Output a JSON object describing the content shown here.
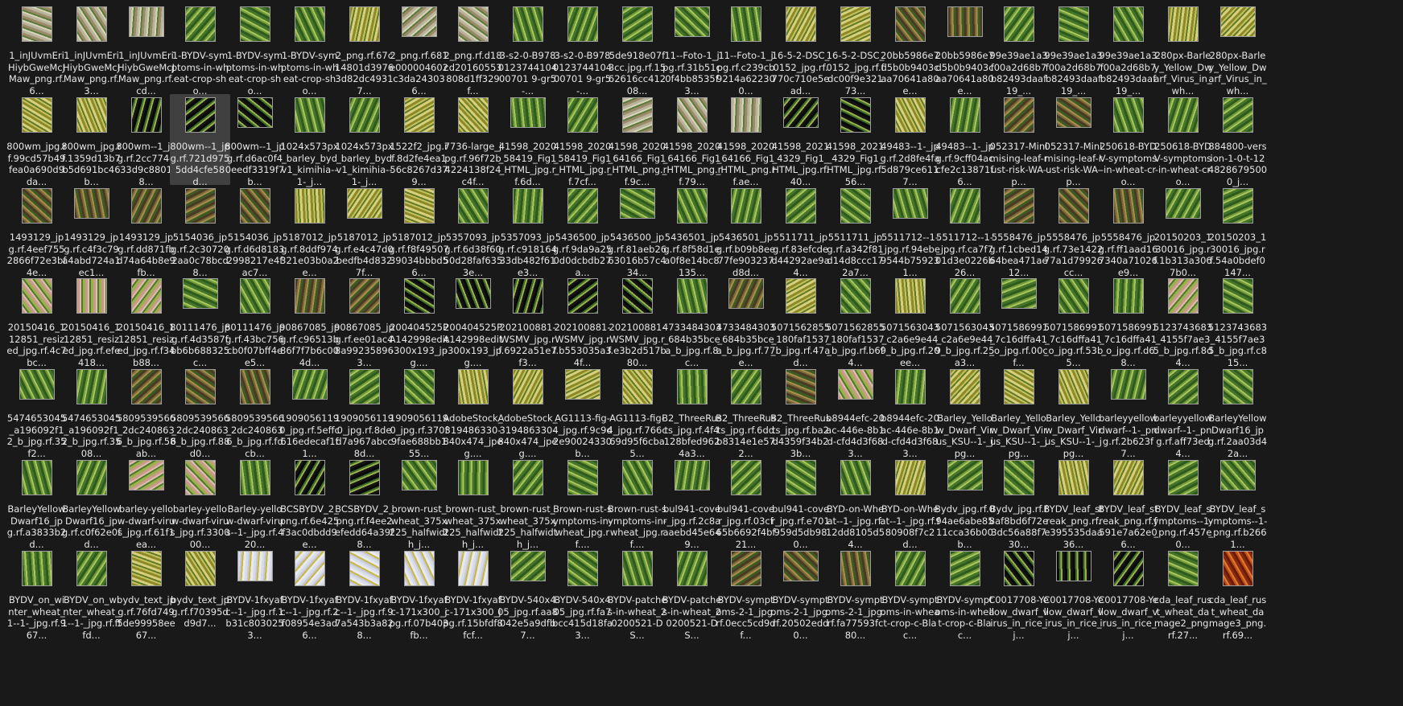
{
  "colors": {
    "background": "#191919",
    "text": "#e6e6e6",
    "selection": "#404040",
    "thumb_border": "#9c9c9c"
  },
  "files": [
    {
      "name": "1_inJUvmEriHiybGweMcJMaw_png.rf.6...",
      "thumb": "pale",
      "selected": false
    },
    {
      "name": "1_inJUvmEriHiybGweMcJMaw_png.rf.3...",
      "thumb": "pale",
      "selected": false
    },
    {
      "name": "1_inJUvmEriHiybGweMcJMaw_png.rf.cd...",
      "thumb": "pale",
      "selected": false
    },
    {
      "name": "1-BYDV-symptoms-in-wheat-crop-sho...",
      "thumb": "green",
      "selected": false
    },
    {
      "name": "1-BYDV-symptoms-in-wheat-crop-sho...",
      "thumb": "green",
      "selected": false
    },
    {
      "name": "1-BYDV-symptoms-in-wheat-crop-sho...",
      "thumb": "green",
      "selected": false
    },
    {
      "name": "2_png.rf.67c14801d39763d82dc49317...",
      "thumb": "yellow",
      "selected": false
    },
    {
      "name": "2_png.rf.681e000004602c3da243036...",
      "thumb": "pale",
      "selected": false
    },
    {
      "name": "2_png.rf.d18cd20160553808d1ff329f...",
      "thumb": "pale",
      "selected": false
    },
    {
      "name": "3-s2-0-B978012374410400701 9-gr5-...",
      "thumb": "green",
      "selected": false
    },
    {
      "name": "3-s2-0-B978012374410400701 9-gr5-...",
      "thumb": "green",
      "selected": false
    },
    {
      "name": "5de918e07f3cc.jpg.rf.1562616cc41208...",
      "thumb": "green",
      "selected": false
    },
    {
      "name": "11--Foto-1_jpg.rf.31b51c0f4bb8535f3...",
      "thumb": "green",
      "selected": false
    },
    {
      "name": "11--Foto-1_jpg.rf.c239cb9214a622300...",
      "thumb": "green",
      "selected": false
    },
    {
      "name": "16-5-2-DSC_0152_jpg.rf.770c710e5ead...",
      "thumb": "yellow",
      "selected": false
    },
    {
      "name": "16-5-2-DSC_0152_jpg.rf.fdc00f9e32173...",
      "thumb": "yellow",
      "selected": false
    },
    {
      "name": "20bb5986e7d5b0b9403caa70641a80e...",
      "thumb": "brown",
      "selected": false
    },
    {
      "name": "20bb5986e7d5b0b9403caa70641a80e...",
      "thumb": "brown",
      "selected": false
    },
    {
      "name": "99e39ae1a3f00a2d68b7b82493daaf19_...",
      "thumb": "green",
      "selected": false
    },
    {
      "name": "99e39ae1a3f00a2d68b7b82493daaf19_...",
      "thumb": "green",
      "selected": false
    },
    {
      "name": "99e39ae1a3f00a2d68b7b82493daaf19_...",
      "thumb": "green",
      "selected": false
    },
    {
      "name": "280px-Barley_Yellow_Dwarf_Virus_in_wh...",
      "thumb": "yellow",
      "selected": false
    },
    {
      "name": "280px-Barley_Yellow_Dwarf_Virus_in_wh...",
      "thumb": "yellow",
      "selected": false
    },
    {
      "name": "800wm_jpg.rf.99cd57b49fea0a690d9da...",
      "thumb": "yellow",
      "selected": false
    },
    {
      "name": "800wm_jpg.rf.1359d13b7b5d691bc46b...",
      "thumb": "yellow",
      "selected": false
    },
    {
      "name": "800wm--1_jpg.rf.2cc774e33d9c88018...",
      "thumb": "dark",
      "selected": false
    },
    {
      "name": "800wm--1_jpg.rf.721d9755dd4cfe58d...",
      "thumb": "dark",
      "selected": true
    },
    {
      "name": "800wm--1_jpg.rf.d6ac0f40eedf3319f7b...",
      "thumb": "dark",
      "selected": false
    },
    {
      "name": "1024x573px_barley_bydv1_kimihia--1-_j...",
      "thumb": "green",
      "selected": false
    },
    {
      "name": "1024x573px_barley_bydv1_kimihia--1-_j...",
      "thumb": "green",
      "selected": false
    },
    {
      "name": "1522f2_jpg.rf.8d2fe4ea156c8267d379...",
      "thumb": "yellow",
      "selected": false
    },
    {
      "name": "7736-large_jpg.rf.96f72b4224138f24c4f...",
      "thumb": "yellow",
      "selected": false
    },
    {
      "name": "41598_2020_58419_Fig1_HTML_jpg.rf.6d...",
      "thumb": "green",
      "selected": false
    },
    {
      "name": "41598_2020_58419_Fig1_HTML_jpg.rf.7cf...",
      "thumb": "green",
      "selected": false
    },
    {
      "name": "41598_2020_64166_Fig1_HTML_png.rf.9c...",
      "thumb": "pale",
      "selected": false
    },
    {
      "name": "41598_2020_64166_Fig1_HTML_png.rf.79...",
      "thumb": "pale",
      "selected": false
    },
    {
      "name": "41598_2020_64166_Fig1_HTML_png.rf.ae...",
      "thumb": "pale",
      "selected": false
    },
    {
      "name": "41598_2021_4329_Fig1_HTML_jpg.rf.40...",
      "thumb": "dark",
      "selected": false
    },
    {
      "name": "41598_2021_4329_Fig1_HTML_jpg.rf.56...",
      "thumb": "dark",
      "selected": false
    },
    {
      "name": "49483--1-_jpg.rf.2d8fe4fa5d879ce6117...",
      "thumb": "yellow",
      "selected": false
    },
    {
      "name": "49483--1-_jpg.rf.9cff04accfe2c13871f6...",
      "thumb": "green",
      "selected": false
    },
    {
      "name": "052317-Minimising-leaf-rust-risk-WA-p...",
      "thumb": "brown",
      "selected": false
    },
    {
      "name": "052317-Minimising-leaf-rust-risk-WA-p...",
      "thumb": "brown",
      "selected": false
    },
    {
      "name": "250618-BYDV-symptoms-in-wheat-cro...",
      "thumb": "green",
      "selected": false
    },
    {
      "name": "250618-BYDV-symptoms-in-wheat-cro...",
      "thumb": "green",
      "selected": false
    },
    {
      "name": "884800-version-1-0-t-1248286795000_j...",
      "thumb": "green",
      "selected": false
    },
    {
      "name": "1493129_jpg.rf.4eef7552866f72e3bf4e...",
      "thumb": "brown",
      "selected": false
    },
    {
      "name": "1493129_jpg.rf.c4f3c79a4abd724a1ec1...",
      "thumb": "brown",
      "selected": false
    },
    {
      "name": "1493129_jpg.rf.dd871fbd74a64b8e9fb...",
      "thumb": "brown",
      "selected": false
    },
    {
      "name": "5154036_jpg.rf.2c307202aa0c78bcd8...",
      "thumb": "brown",
      "selected": false
    },
    {
      "name": "5154036_jpg.rf.d6d81832998217e4fac7...",
      "thumb": "brown",
      "selected": false
    },
    {
      "name": "5187012_jpg.rf.8ddf974321e03b0a2e...",
      "thumb": "yellow",
      "selected": false
    },
    {
      "name": "5187012_jpg.rf.e4c47d0bedfb4d8327f...",
      "thumb": "yellow",
      "selected": false
    },
    {
      "name": "5187012_jpg.rf.f8f4950739034bbbd56...",
      "thumb": "yellow",
      "selected": false
    },
    {
      "name": "5357093_jpg.rf.6d38f6050d28faf6353e...",
      "thumb": "green",
      "selected": false
    },
    {
      "name": "5357093_jpg.rf.c91816433db482f61e3...",
      "thumb": "green",
      "selected": false
    },
    {
      "name": "5436500_jpg.rf.9da9a250d0dcbdb27a...",
      "thumb": "green",
      "selected": false
    },
    {
      "name": "5436500_jpg.rf.81aeb2663016b57c434...",
      "thumb": "green",
      "selected": false
    },
    {
      "name": "5436501_jpg.rf.8f58d1ea0f8e14bc8135...",
      "thumb": "green",
      "selected": false
    },
    {
      "name": "5436501_jpg.rf.b09b8ee77fe903237d8d...",
      "thumb": "green",
      "selected": false
    },
    {
      "name": "5511711_jpg.rf.83efcded44292ae9a4...",
      "thumb": "green",
      "selected": false
    },
    {
      "name": "5511711_jpg.rf.a342f81d14d8ccc172a7...",
      "thumb": "green",
      "selected": false
    },
    {
      "name": "5511712--1-_jpg.rf.94ebe9544b759231...",
      "thumb": "green",
      "selected": false
    },
    {
      "name": "5511712--1-_jpg.rf.ca7f701d3e0226b26...",
      "thumb": "green",
      "selected": false
    },
    {
      "name": "5558476_jpg.rf.1cbed1464bea471ae12...",
      "thumb": "brown",
      "selected": false
    },
    {
      "name": "5558476_jpg.rf.73e142277a1d79926cc...",
      "thumb": "brown",
      "selected": false
    },
    {
      "name": "5558476_jpg.rf.ff1aad167340a71026e9...",
      "thumb": "brown",
      "selected": false
    },
    {
      "name": "20150203_130016_jpg.rf.1b313a3067b0...",
      "thumb": "green",
      "selected": false
    },
    {
      "name": "20150203_130016_jpg.rf.54a0bdef0147...",
      "thumb": "green",
      "selected": false
    },
    {
      "name": "20150416_112851_resized_jpg.rf.4c7bc...",
      "thumb": "pink",
      "selected": false
    },
    {
      "name": "20150416_112851_resized_jpg.rf.efe418...",
      "thumb": "pink",
      "selected": false
    },
    {
      "name": "20150416_112851_resized_jpg.rf.f34b88...",
      "thumb": "pink",
      "selected": false
    },
    {
      "name": "80111476_jpg.rf.4d3587fbb6b688325c...",
      "thumb": "green",
      "selected": false
    },
    {
      "name": "80111476_jpg.rf.43bc756cb0f07bff4ee5...",
      "thumb": "green",
      "selected": false
    },
    {
      "name": "90867085_jpg.rf.c96513b86f7f7b6c004d...",
      "thumb": "brown",
      "selected": false
    },
    {
      "name": "90867085_jpg.rf.ee01ac48a992358963...",
      "thumb": "brown",
      "selected": false
    },
    {
      "name": "200404525PA142998edit-300x193_jpg....",
      "thumb": "dark",
      "selected": false
    },
    {
      "name": "200404525PA142998edit-300x193_jpg....",
      "thumb": "dark",
      "selected": false
    },
    {
      "name": "202100881-WSMV_jpg.rf.6922a51e7f3...",
      "thumb": "dark",
      "selected": false
    },
    {
      "name": "202100881-WSMV_jpg.rf.b553035a34f...",
      "thumb": "dark",
      "selected": false
    },
    {
      "name": "202100881-WSMV_jpg.rf.e3b2d517b80...",
      "thumb": "dark",
      "selected": false
    },
    {
      "name": "4733484303_684b35bcea_b_jpg.rf.8c...",
      "thumb": "green",
      "selected": false
    },
    {
      "name": "4733484303_684b35bcea_b_jpg.rf.77e...",
      "thumb": "brown",
      "selected": false
    },
    {
      "name": "5071562855_180faf1537_b_jpg.rf.47ad...",
      "thumb": "yellow",
      "selected": false
    },
    {
      "name": "5071562855_180faf1537_b_jpg.rf.b6f4...",
      "thumb": "green",
      "selected": false
    },
    {
      "name": "5071563043_c2a6e9e449_b_jpg.rf.20ee...",
      "thumb": "yellow",
      "selected": false
    },
    {
      "name": "5071563043_c2a6e9e449_b_jpg.rf.25a3...",
      "thumb": "green",
      "selected": false
    },
    {
      "name": "5071586991_7c16dffa41_o_jpg.rf.00cf...",
      "thumb": "green",
      "selected": false
    },
    {
      "name": "5071586991_7c16dffa41_o_jpg.rf.53b5...",
      "thumb": "green",
      "selected": false
    },
    {
      "name": "5071586991_7c16dffa41_o_jpg.rf.d68...",
      "thumb": "green",
      "selected": false
    },
    {
      "name": "5123743683_4155f7ae35_b_jpg.rf.8d4...",
      "thumb": "pink",
      "selected": false
    },
    {
      "name": "5123743683_4155f7ae35_b_jpg.rf.c815...",
      "thumb": "green",
      "selected": false
    },
    {
      "name": "5474653045_a196092f12_b_jpg.rf.35f2...",
      "thumb": "green",
      "selected": false
    },
    {
      "name": "5474653045_a196092f12_b_jpg.rf.3508...",
      "thumb": "green",
      "selected": false
    },
    {
      "name": "5809539566_2dc2408636_b_jpg.rf.58ab...",
      "thumb": "brown",
      "selected": false
    },
    {
      "name": "5809539566_2dc2408636_b_jpg.rf.88d0...",
      "thumb": "brown",
      "selected": false
    },
    {
      "name": "5809539566_2dc2408636_b_jpg.rf.fdcb...",
      "thumb": "brown",
      "selected": false
    },
    {
      "name": "19090561190_jpg.rf.5effc616edecaf1f1...",
      "thumb": "green",
      "selected": false
    },
    {
      "name": "19090561190_jpg.rf.8ded7a967abcc8d...",
      "thumb": "green",
      "selected": false
    },
    {
      "name": "19090561190_jpg.rf.370f9fae688bb155...",
      "thumb": "green",
      "selected": false
    },
    {
      "name": "AdobeStock_319486330-840x474_jpeg....",
      "thumb": "yellow",
      "selected": false
    },
    {
      "name": "AdobeStock_319486330-840x474_jpeg....",
      "thumb": "yellow",
      "selected": false
    },
    {
      "name": "AG1113-fig-4_jpg.rf.9c9d2e90024330b...",
      "thumb": "yellow",
      "selected": false
    },
    {
      "name": "AG1113-fig-4_jpg.rf.766c69d95f6cba5...",
      "thumb": "yellow",
      "selected": false
    },
    {
      "name": "B2_ThreeRusts_jpg.rf.4f4128bfed9624a3...",
      "thumb": "green",
      "selected": false
    },
    {
      "name": "B2_ThreeRusts_jpg.rf.6ddb8314e1e572...",
      "thumb": "green",
      "selected": false
    },
    {
      "name": "B2_ThreeRusts_jpg.rf.ba2d4359f34b23b...",
      "thumb": "brown",
      "selected": false
    },
    {
      "name": "b8944efc-20ac-446e-8b1d-cfd4d3f683...",
      "thumb": "pink",
      "selected": false
    },
    {
      "name": "b8944efc-20ac-446e-8b1d-cfd4d3f683...",
      "thumb": "green",
      "selected": false
    },
    {
      "name": "Barley_Yellow_Dwarf_Virus_KSU--1-_jpg...",
      "thumb": "yellow",
      "selected": false
    },
    {
      "name": "Barley_Yellow_Dwarf_Virus_KSU--1-_jpg...",
      "thumb": "yellow",
      "selected": false
    },
    {
      "name": "Barley_Yellow_Dwarf_Virus_KSU--1-_jpg...",
      "thumb": "yellow",
      "selected": false
    },
    {
      "name": "barleyyellowdwarf--1-_png.rf.2b623f7...",
      "thumb": "green",
      "selected": false
    },
    {
      "name": "barleyyellowdwarf--1-_png.rf.aff73ed4...",
      "thumb": "green",
      "selected": false
    },
    {
      "name": "BarleyYellowDwarf16_jpg.rf.2aa03d42a...",
      "thumb": "green",
      "selected": false
    },
    {
      "name": "BarleyYellowDwarf16_jpg.rf.a3833b2d...",
      "thumb": "green",
      "selected": false
    },
    {
      "name": "BarleyYellowDwarf16_jpg.rf.c0f62e0fd...",
      "thumb": "green",
      "selected": false
    },
    {
      "name": "barley-yellow-dwarf-virus_jpg.rf.61f1ea...",
      "thumb": "pink",
      "selected": false
    },
    {
      "name": "barley-yellow-dwarf-virus_jpg.rf.330000...",
      "thumb": "pink",
      "selected": false
    },
    {
      "name": "Barley-yellow-dwarf-virus--1-_jpg.rf.420...",
      "thumb": "green",
      "selected": false
    },
    {
      "name": "BCSBYDV_2_png.rf.6e425f3ac0dbdd9e...",
      "thumb": "dark",
      "selected": false
    },
    {
      "name": "BCSBYDV_2_png.rf.f4ee2efedd64a39f8...",
      "thumb": "dark",
      "selected": false
    },
    {
      "name": "brown-rust_wheat_375x225_halfwidth_j...",
      "thumb": "green",
      "selected": false
    },
    {
      "name": "brown-rust_wheat_375x225_halfwidth_j...",
      "thumb": "green",
      "selected": false
    },
    {
      "name": "brown-rust_wheat_375x225_halfwidth_j...",
      "thumb": "green",
      "selected": false
    },
    {
      "name": "Brown-rust-symptoms-in-wheat_jpg.rf....",
      "thumb": "green",
      "selected": false
    },
    {
      "name": "Brown-rust-symptoms-in-wheat_jpg.rf....",
      "thumb": "green",
      "selected": false
    },
    {
      "name": "bul941-cover_jpg.rf.2c8aaaebd45e649...",
      "thumb": "green",
      "selected": false
    },
    {
      "name": "bul941-cover_jpg.rf.03cf65b6692f4bf21...",
      "thumb": "green",
      "selected": false
    },
    {
      "name": "bul941-cover_jpg.rf.e701959d5db980...",
      "thumb": "green",
      "selected": false
    },
    {
      "name": "BYD-on-Wheat--1-_jpg.rf.12dd8105d54...",
      "thumb": "green",
      "selected": false
    },
    {
      "name": "BYD-on-Wheat--1-_jpg.rf.f80908f7c2d...",
      "thumb": "yellow",
      "selected": false
    },
    {
      "name": "Bydv_jpg.rf.094ae6abe8511cca36b00b...",
      "thumb": "green",
      "selected": false
    },
    {
      "name": "Bydv_jpg.rf.f8af8bd6f72e3dc56a88f730...",
      "thumb": "green",
      "selected": false
    },
    {
      "name": "BYDV_leaf_streak_png.rf.e395535daa36...",
      "thumb": "yellow",
      "selected": false
    },
    {
      "name": "BYDV_leaf_streak_png.rf.f591e7a62e06...",
      "thumb": "yellow",
      "selected": false
    },
    {
      "name": "BYDV_leaf_symptoms--1-_png.rf.457e0...",
      "thumb": "green",
      "selected": false
    },
    {
      "name": "BYDV_leaf_symptoms--1-_png.rf.b2661...",
      "thumb": "green",
      "selected": false
    },
    {
      "name": "BYDV_on_winter_wheat_1--1-_jpg.rf.967...",
      "thumb": "green",
      "selected": false
    },
    {
      "name": "BYDV_on_winter_wheat_1--1-_jpg.rf.fffd...",
      "thumb": "green",
      "selected": false
    },
    {
      "name": "bydv_text_jpg.rf.76fd7495de99958ee67...",
      "thumb": "yellow",
      "selected": false
    },
    {
      "name": "bydv_text_jpg.rf.f70395dd9d7...",
      "thumb": "yellow",
      "selected": false
    },
    {
      "name": "BYDV-1fxyafc--1-_jpg.rf.1b31c8030253...",
      "thumb": "light",
      "selected": false
    },
    {
      "name": "BYDV-1fxyafc--1-_jpg.rf.2f08954e3ad6...",
      "thumb": "light",
      "selected": false
    },
    {
      "name": "BYDV-1fxyafc--1-_jpg.rf.97a543b3a828...",
      "thumb": "light",
      "selected": false
    },
    {
      "name": "BYDV-1fxyafc-171x300_jpg.rf.07b403fb...",
      "thumb": "light",
      "selected": false
    },
    {
      "name": "BYDV-1fxyafc-171x300_jpg.rf.15bfdf8fcf...",
      "thumb": "light",
      "selected": false
    },
    {
      "name": "BYDV-540x405_jpg.rf.aa8042e5a9dfb7...",
      "thumb": "green",
      "selected": false
    },
    {
      "name": "BYDV-540x405_jpg.rf.fa7bcc415d18fa3...",
      "thumb": "green",
      "selected": false
    },
    {
      "name": "BYDV-patches-in-wheat_20200521-DS...",
      "thumb": "green",
      "selected": false
    },
    {
      "name": "BYDV-patches-in-wheat_20200521-DS...",
      "thumb": "green",
      "selected": false
    },
    {
      "name": "BYDV-symptoms-2-1_jpg.rf.0ecc5cd9df...",
      "thumb": "brown",
      "selected": false
    },
    {
      "name": "BYDV-symptoms-2-1_jpg.rf.20502edd0...",
      "thumb": "brown",
      "selected": false
    },
    {
      "name": "BYDV-symptoms-2-1_jpg.rf.fa77593fc80...",
      "thumb": "brown",
      "selected": false
    },
    {
      "name": "BYDV-symptoms-in-wheat-crop-c-Blac...",
      "thumb": "green",
      "selected": false
    },
    {
      "name": "BYDV-symptoms-in-wheat-crop-c-Blac...",
      "thumb": "green",
      "selected": false
    },
    {
      "name": "C0017708-Yellow_dwarf_virus_in_rice_j...",
      "thumb": "dark",
      "selected": false
    },
    {
      "name": "C0017708-Yellow_dwarf_virus_in_rice_j...",
      "thumb": "dark",
      "selected": false
    },
    {
      "name": "C0017708-Yellow_dwarf_virus_in_rice_j...",
      "thumb": "dark",
      "selected": false
    },
    {
      "name": "cda_leaf_rust_wheat_damage2_png.rf.27...",
      "thumb": "green",
      "selected": false
    },
    {
      "name": "cda_leaf_rust_wheat_damage3_png.rf.69...",
      "thumb": "red",
      "selected": false
    }
  ]
}
